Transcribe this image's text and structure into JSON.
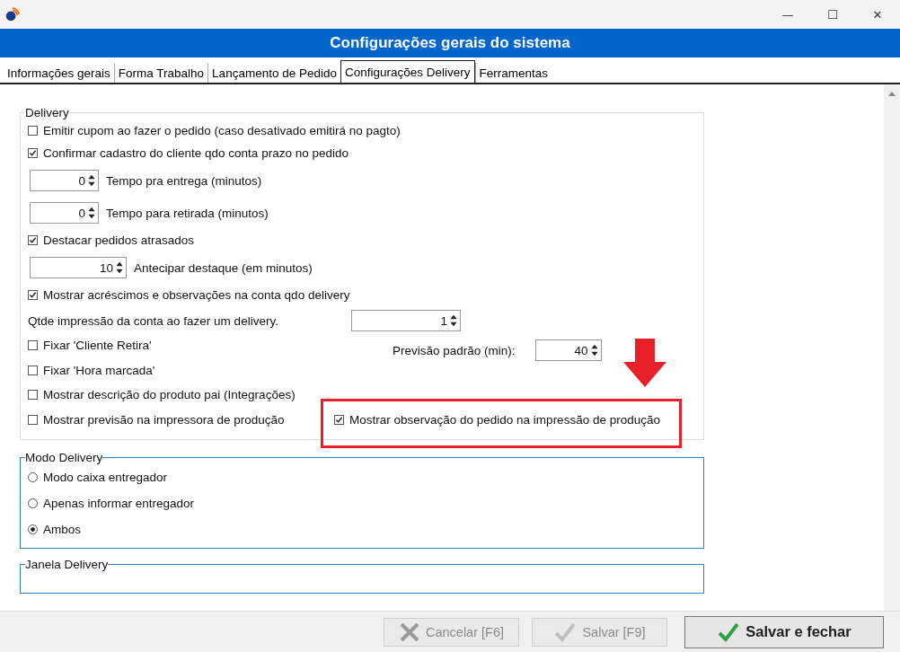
{
  "window": {
    "controls": [
      "—",
      "☐",
      "✕"
    ]
  },
  "header": {
    "title": "Configurações gerais do sistema"
  },
  "tabs": [
    {
      "label": "Informações gerais",
      "selected": false
    },
    {
      "label": "Forma Trabalho",
      "selected": false
    },
    {
      "label": "Lançamento de Pedido",
      "selected": false
    },
    {
      "label": "Configurações Delivery",
      "selected": true
    },
    {
      "label": "Ferramentas",
      "selected": false
    }
  ],
  "delivery_group": {
    "title": "Delivery",
    "items": [
      {
        "kind": "checkbox",
        "label": "Emitir cupom ao fazer o pedido (caso desativado emitirá no pagto)",
        "checked": false
      },
      {
        "kind": "checkbox",
        "label": "Confirmar cadastro do cliente  qdo conta prazo no pedido",
        "checked": true
      },
      {
        "kind": "spinner",
        "value": "0",
        "label": "Tempo pra entrega (minutos)"
      },
      {
        "kind": "spinner",
        "value": "0",
        "label": "Tempo para retirada (minutos)"
      },
      {
        "kind": "checkbox",
        "label": "Destacar pedidos atrasados",
        "checked": true
      },
      {
        "kind": "spinner_wide",
        "value": "10",
        "label": "Antecipar destaque (em minutos)"
      },
      {
        "kind": "checkbox",
        "label": "Mostrar acréscimos e observações na conta qdo delivery",
        "checked": true
      },
      {
        "kind": "labeled_spinner",
        "label": "Qtde impressão da conta ao fazer um delivery.",
        "value": "1"
      }
    ],
    "left_checkboxes": [
      {
        "label": "Fixar 'Cliente Retira'",
        "checked": false
      },
      {
        "label": "Fixar 'Hora marcada'",
        "checked": false
      },
      {
        "label": "Mostrar descrição do produto pai (Integrações)",
        "checked": false
      },
      {
        "label": "Mostrar previsão na impressora de produção",
        "checked": false
      }
    ],
    "forecast": {
      "label": "Previsão padrão (min):",
      "value": "40"
    },
    "production_note": {
      "label": "Mostrar observação do pedido na impressão de produção",
      "checked": true,
      "highlighted": true
    }
  },
  "mode_group": {
    "title": "Modo Delivery",
    "options": [
      {
        "label": "Modo caixa entregador",
        "selected": false
      },
      {
        "label": "Apenas informar entregador",
        "selected": false
      },
      {
        "label": "Ambos",
        "selected": true
      }
    ]
  },
  "window_group": {
    "title": "Janela Delivery"
  },
  "buttons": [
    {
      "kind": "cancel",
      "label": "Cancelar [F6]",
      "disabled": true
    },
    {
      "kind": "save",
      "label": "Salvar [F9]",
      "disabled": true
    },
    {
      "kind": "save_close",
      "label": "Salvar e fechar",
      "disabled": false
    }
  ]
}
